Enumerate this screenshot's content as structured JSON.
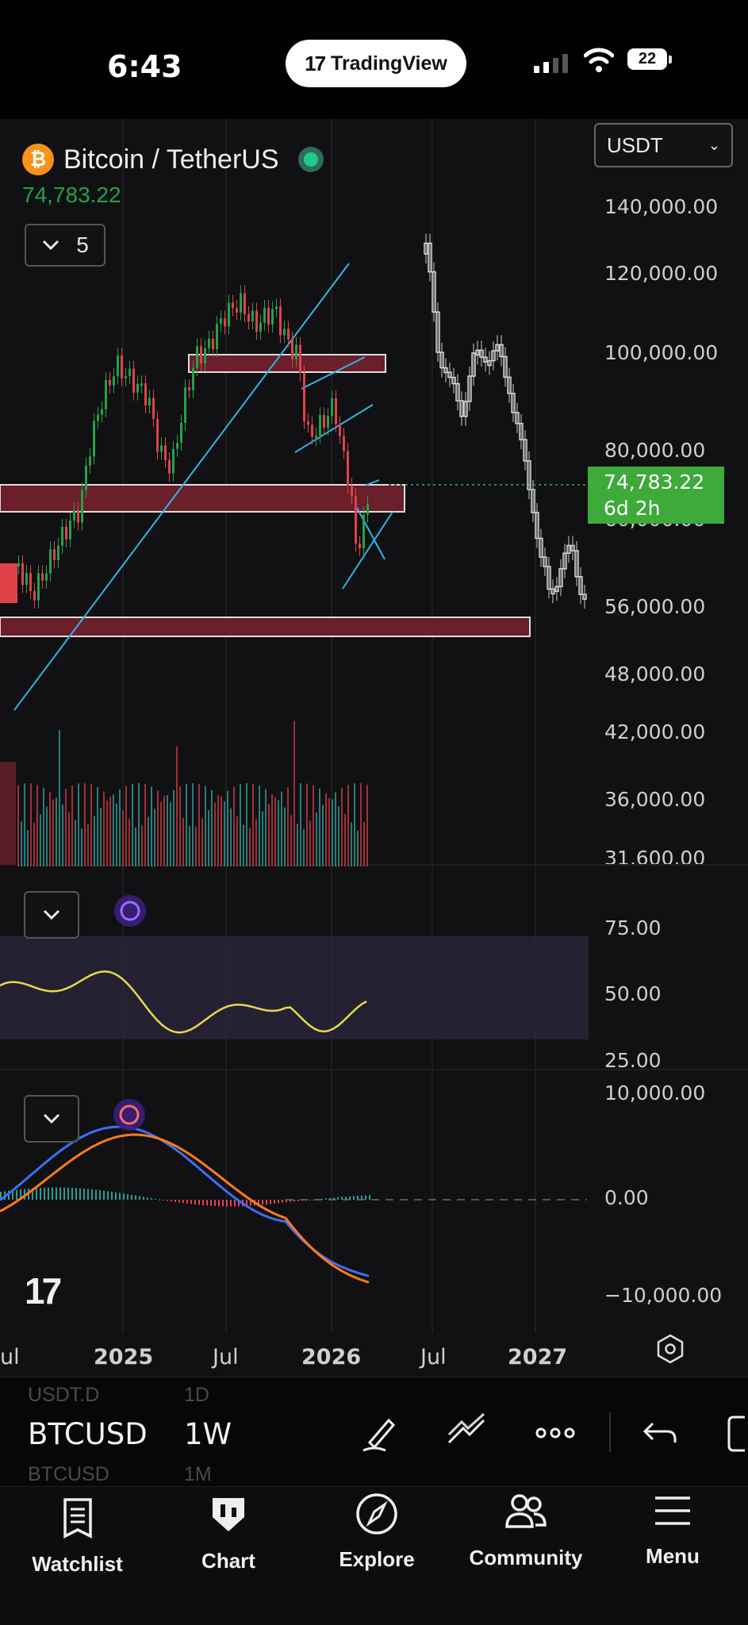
{
  "status_bar": {
    "time": "6:43",
    "app_pill": "TradingView",
    "battery": "22"
  },
  "symbol": {
    "name": "Bitcoin / TetherUS",
    "price": "74,783.22",
    "intervals_count": "5",
    "currency": "USDT"
  },
  "price_axis": [
    "140,000.00",
    "120,000.00",
    "100,000.00",
    "80,000.00",
    "60,000.00",
    "56,000.00",
    "48,000.00",
    "42,000.00",
    "36,000.00",
    "31,600.00"
  ],
  "price_tag": {
    "price": "74,783.22",
    "countdown": "6d 2h"
  },
  "rsi_axis": [
    "75.00",
    "50.00",
    "25.00"
  ],
  "macd_axis": [
    "10,000.00",
    "0.00",
    "−10,000.00"
  ],
  "time_axis": [
    "ul",
    "2025",
    "Jul",
    "2026",
    "Jul",
    "2027"
  ],
  "toolbar": {
    "ghost_ticker_top": "USDT.D",
    "ticker": "BTCUSD",
    "ghost_ticker_bottom": "BTCUSD",
    "ghost_interval_top": "1D",
    "interval": "1W",
    "ghost_interval_bottom": "1M"
  },
  "tabs": [
    "Watchlist",
    "Chart",
    "Explore",
    "Community",
    "Menu"
  ],
  "colors": {
    "up": "#24a148",
    "down": "#e0424a",
    "trendline": "#2fb4e6",
    "rsi": "#e8d84a",
    "macd": "#3b6ff5",
    "signal": "#ff7a1a",
    "zone": "#6a1f2a",
    "price_tag": "#3daa3a",
    "live_dot": "#23c88b"
  },
  "icons": [
    "btc-logo-icon",
    "signal-icon",
    "wifi-icon",
    "chevron-down-icon",
    "settings-hex-icon",
    "pen-icon",
    "drawing-tools-icon",
    "more-icon",
    "undo-icon",
    "watchlist-icon",
    "chart-icon",
    "explore-compass-icon",
    "community-icon",
    "menu-icon"
  ]
}
